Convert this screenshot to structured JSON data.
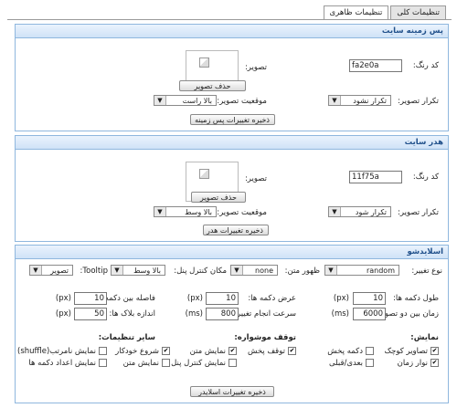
{
  "tabs": [
    {
      "label": "تنظیمات کلی"
    },
    {
      "label": "تنظیمات ظاهری"
    }
  ],
  "background": {
    "title": "پس زمینه سایت",
    "color_label": "کد رنگ:",
    "color_value": "fa2e0a",
    "image_label": "تصویر:",
    "delete_button": "حذف تصویر",
    "repeat_label": "تکرار تصویر:",
    "repeat_value": "تکرار نشود",
    "position_label": "موقعیت تصویر:",
    "position_value": "بالا راست",
    "save_button": "ذخیره تغییرات پس زمینه"
  },
  "header": {
    "title": "هدر سایت",
    "color_label": "کد رنگ:",
    "color_value": "11f75a",
    "image_label": "تصویر:",
    "delete_button": "حذف تصویر",
    "repeat_label": "تکرار تصویر:",
    "repeat_value": "تکرار شود",
    "position_label": "موقعیت تصویر:",
    "position_value": "بالا وسط",
    "save_button": "ذخیره تغییرات هدر"
  },
  "slideshow": {
    "title": "اسلایدشو",
    "type_label": "نوع تغییر:",
    "type_value": "random",
    "text_label": "ظهور متن:",
    "text_value": "none",
    "control_label": "مکان کنترل پنل:",
    "control_value": "بالا وسط",
    "tooltip_label": "Tooltip:",
    "tooltip_value": "تصویر",
    "fields": {
      "btn_height_label": "طول دکمه ها:",
      "btn_height_value": "10",
      "btn_height_unit": "(px)",
      "btn_width_label": "عرض دکمه ها:",
      "btn_width_value": "10",
      "btn_width_unit": "(px)",
      "btn_gap_label": "فاصله بین دکمه ها:",
      "btn_gap_value": "10",
      "btn_gap_unit": "(px)",
      "interval_label": "زمان بین دو تصویر:",
      "interval_value": "6000",
      "interval_unit": "(ms)",
      "speed_label": "سرعت انجام تغییر:",
      "speed_value": "800",
      "speed_unit": "(ms)",
      "block_label": "اندازه بلاک ها:",
      "block_value": "50",
      "block_unit": "(px)"
    },
    "display_title": "نمایش:",
    "display_items": [
      {
        "label": "تصاویر کوچک",
        "checked": true
      },
      {
        "label": "دکمه پخش",
        "checked": false
      },
      {
        "label": "نوار زمان",
        "checked": true
      },
      {
        "label": "بعدی/قبلی",
        "checked": false
      }
    ],
    "hover_title": "توقف موشواره:",
    "hover_items": [
      {
        "label": "توقف پخش",
        "checked": true
      },
      {
        "label": "نمایش متن",
        "checked": true
      },
      {
        "label": "نمایش کنترل پنل",
        "checked": false
      }
    ],
    "other_title": "سایر تنظیمات:",
    "other_items": [
      {
        "label": "شروع خودکار",
        "checked": true
      },
      {
        "label": "نمایش نامرتب(shuffle)",
        "checked": false
      },
      {
        "label": "نمایش متن",
        "checked": false
      },
      {
        "label": "نمایش اعداد دکمه ها",
        "checked": false
      }
    ],
    "save_button": "ذخیره تغییرات اسلایدر"
  }
}
